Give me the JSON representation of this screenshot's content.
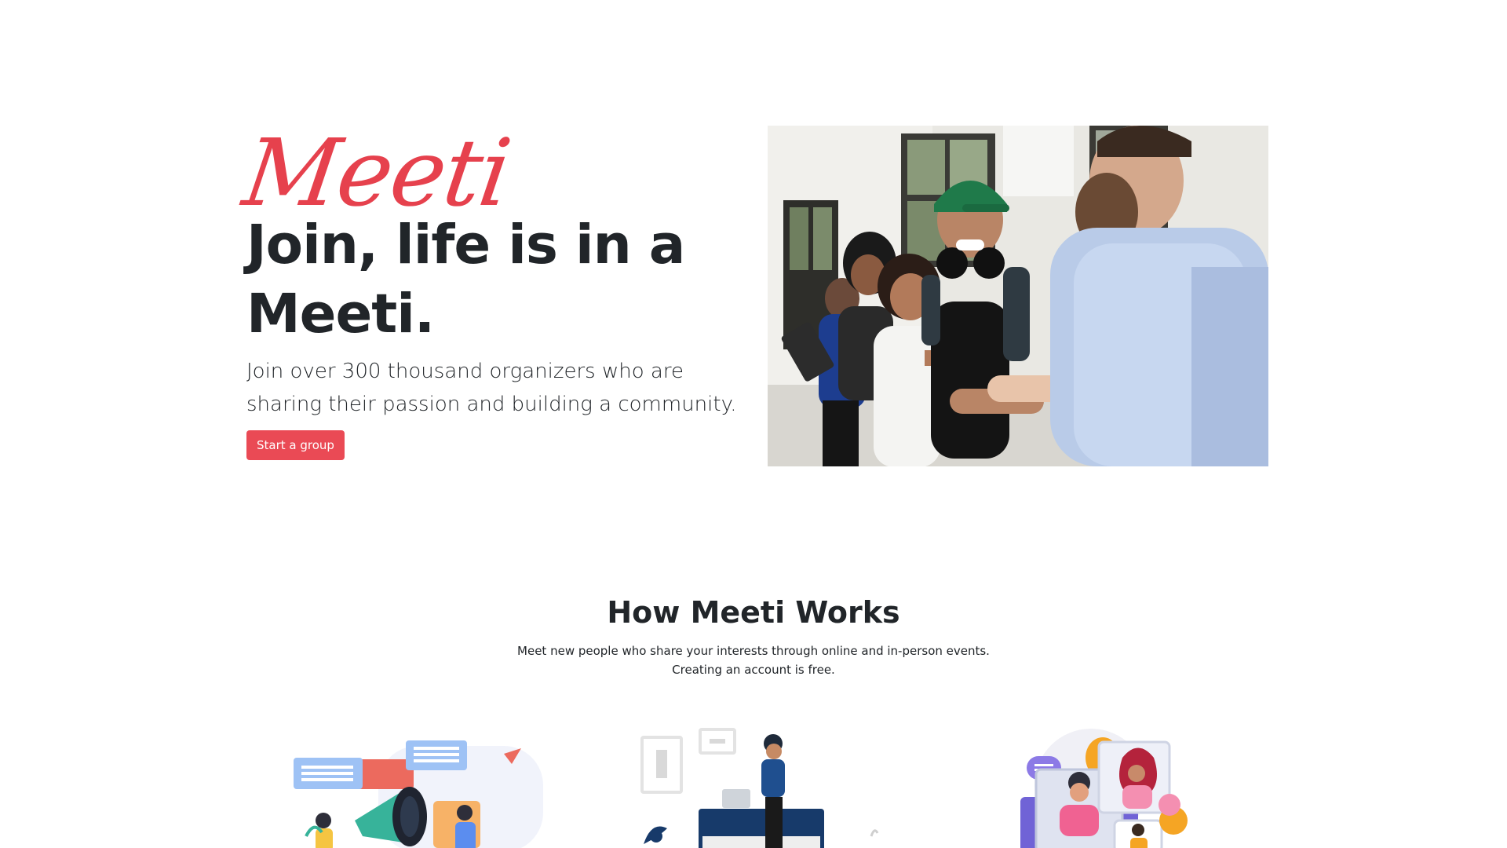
{
  "hero": {
    "brand": "Meeti",
    "headline": "Join, life is in a Meeti.",
    "lead": "Join over 300 thousand organizers who are sharing their passion and building a community.",
    "cta_label": "Start a group",
    "photo_icon": "people-handshake-photo"
  },
  "how": {
    "title": "How Meeti Works",
    "description": "Meet new people who share your interests through online and in-person events. Creating an account is free."
  },
  "colors": {
    "brand": "#e6414d",
    "button": "#ea4a55",
    "text": "#212529"
  },
  "illustrations": [
    "megaphone-illustration",
    "workspace-illustration",
    "video-call-illustration"
  ]
}
